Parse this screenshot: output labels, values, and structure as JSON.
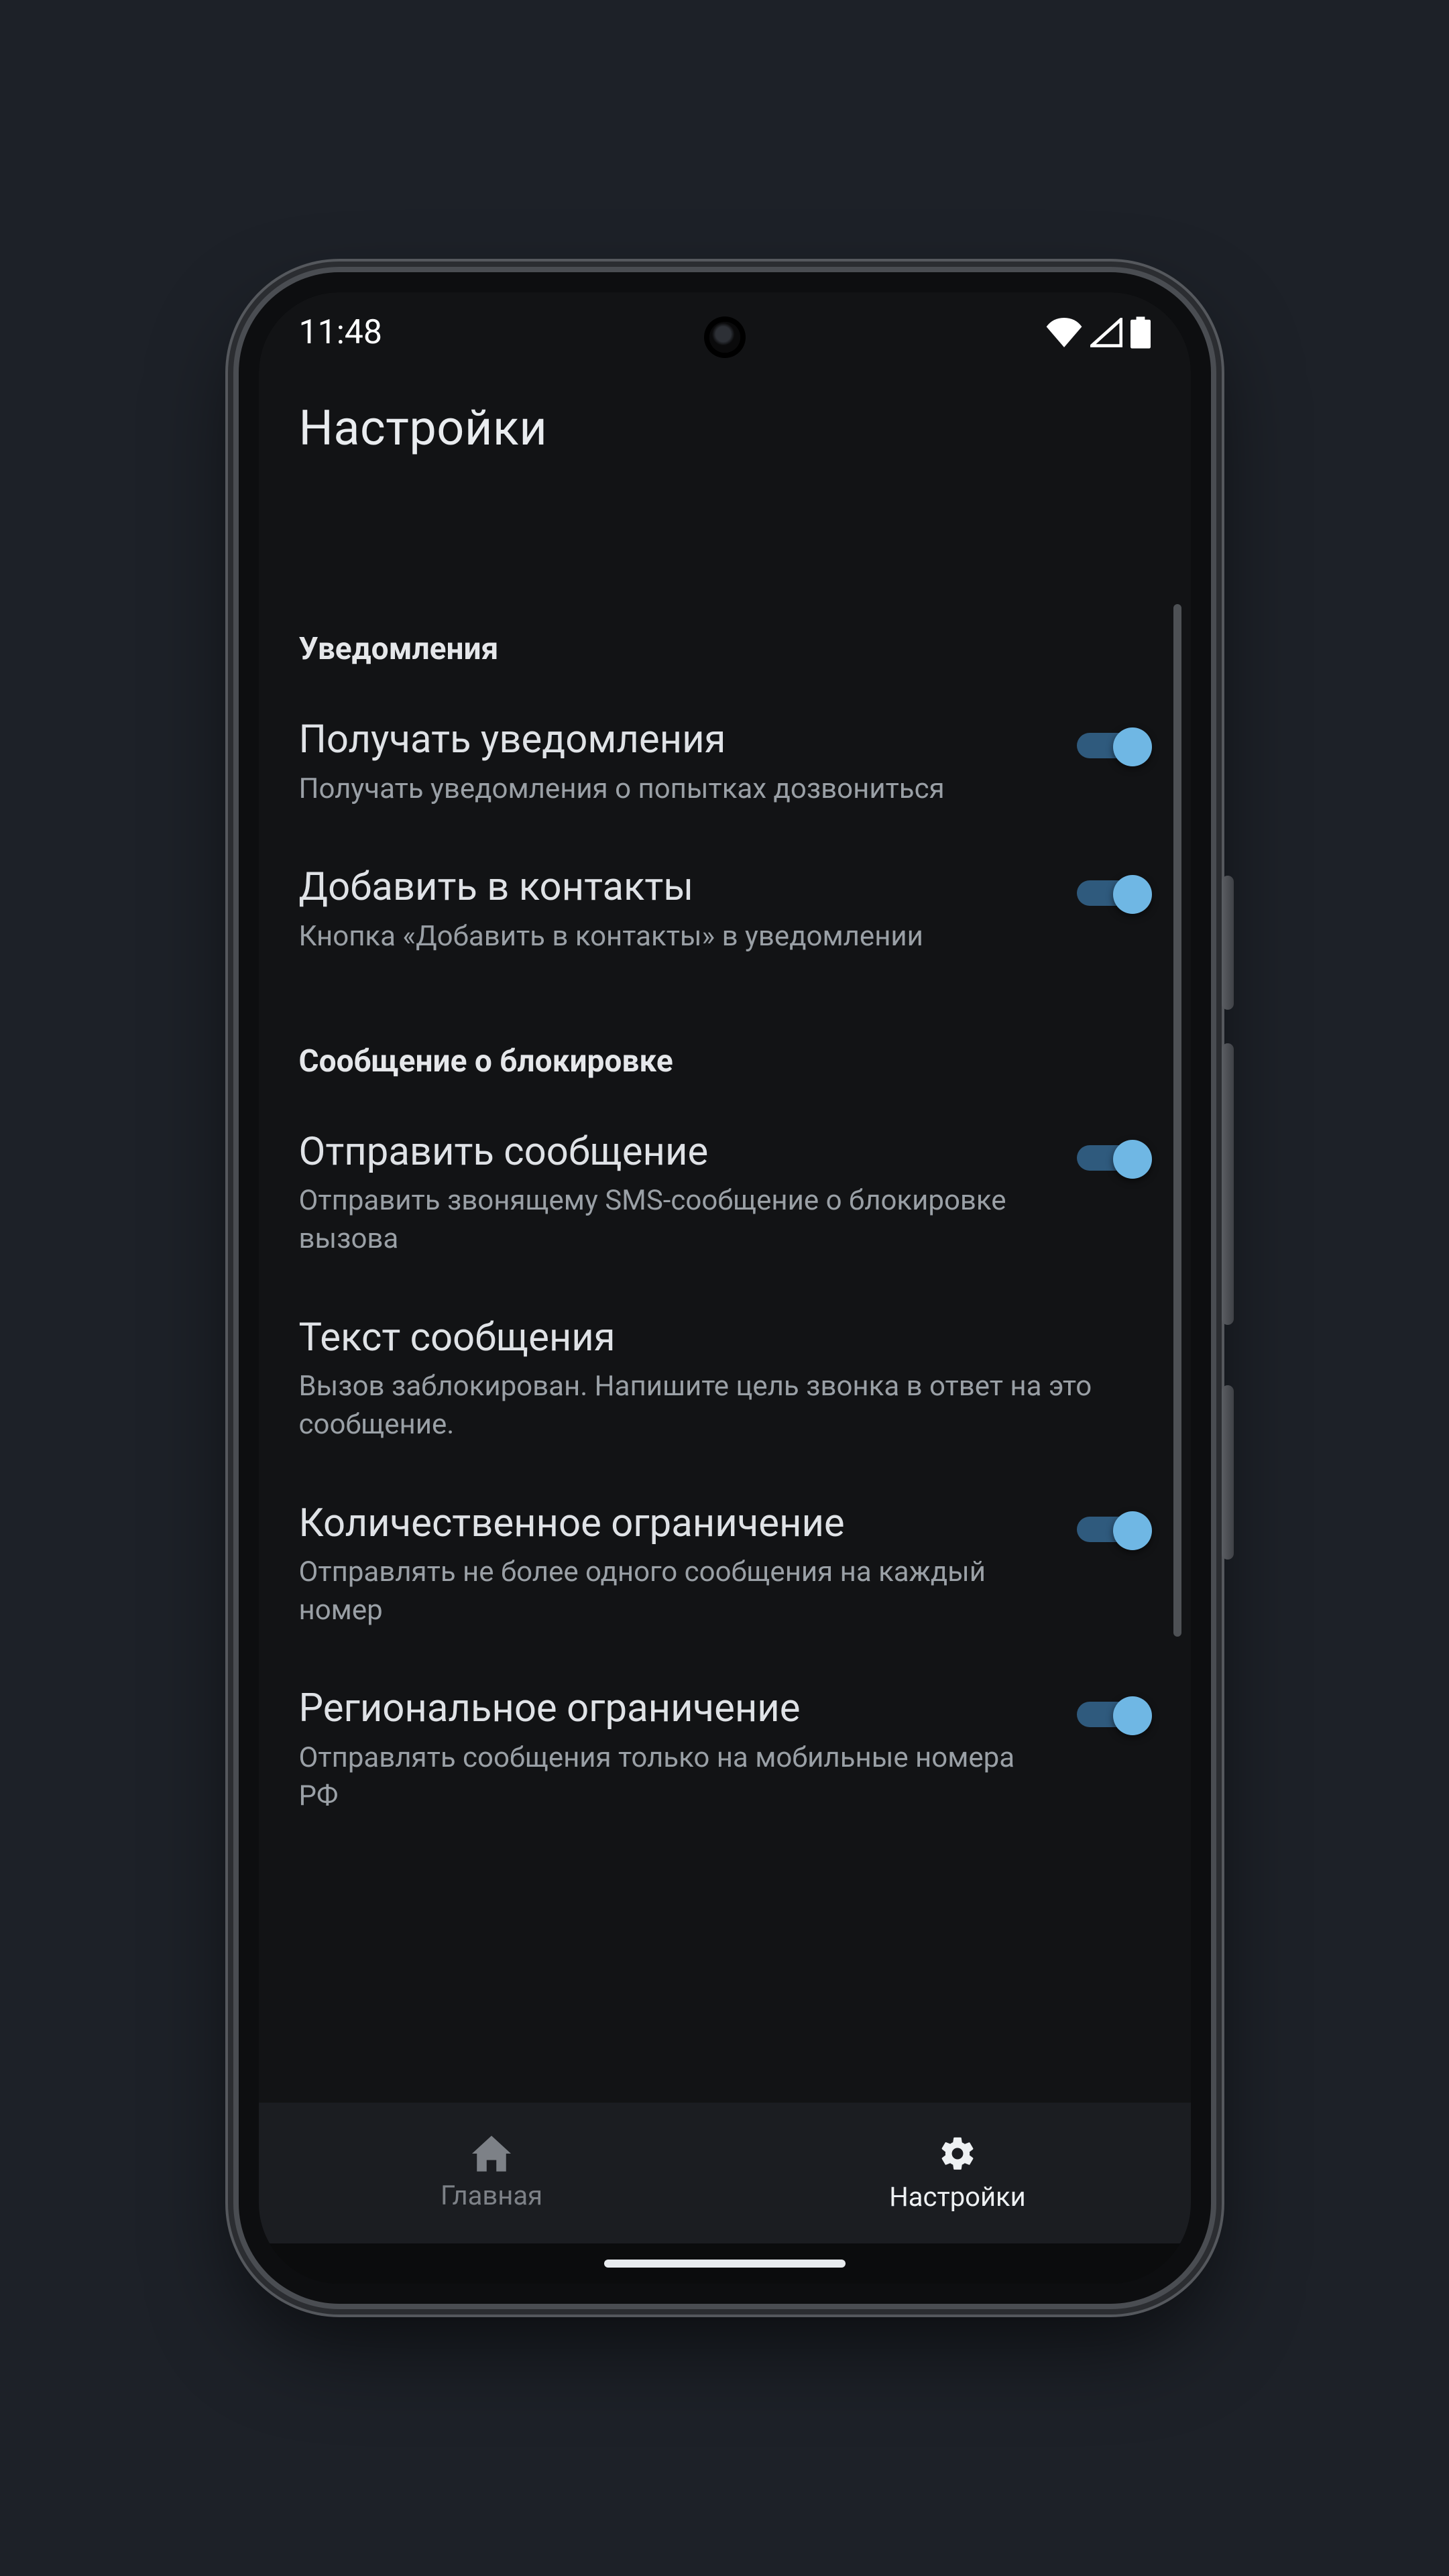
{
  "status": {
    "time": "11:48"
  },
  "appbar": {
    "title": "Настройки"
  },
  "sections": {
    "notifications": {
      "header": "Уведомления",
      "receive": {
        "title": "Получать уведомления",
        "desc": "Получать уведомления о попытках дозвониться",
        "enabled": true
      },
      "addContact": {
        "title": "Добавить в контакты",
        "desc": "Кнопка «Добавить в контакты» в уведомлении",
        "enabled": true
      }
    },
    "blockMessage": {
      "header": "Сообщение о блокировке",
      "send": {
        "title": "Отправить сообщение",
        "desc": "Отправить звонящему SMS-сообщение о блокировке вызова",
        "enabled": true
      },
      "text": {
        "title": "Текст сообщения",
        "desc": "Вызов заблокирован. Напишите цель звонка в ответ на это сообщение."
      },
      "quantityLimit": {
        "title": "Количественное ограничение",
        "desc": "Отправлять не более одного сообщения на каждый номер",
        "enabled": true
      },
      "regionLimit": {
        "title": "Региональное ограничение",
        "desc": "Отправлять сообщения только на мобильные номера РФ",
        "enabled": true
      }
    }
  },
  "nav": {
    "home": "Главная",
    "settings": "Настройки"
  }
}
